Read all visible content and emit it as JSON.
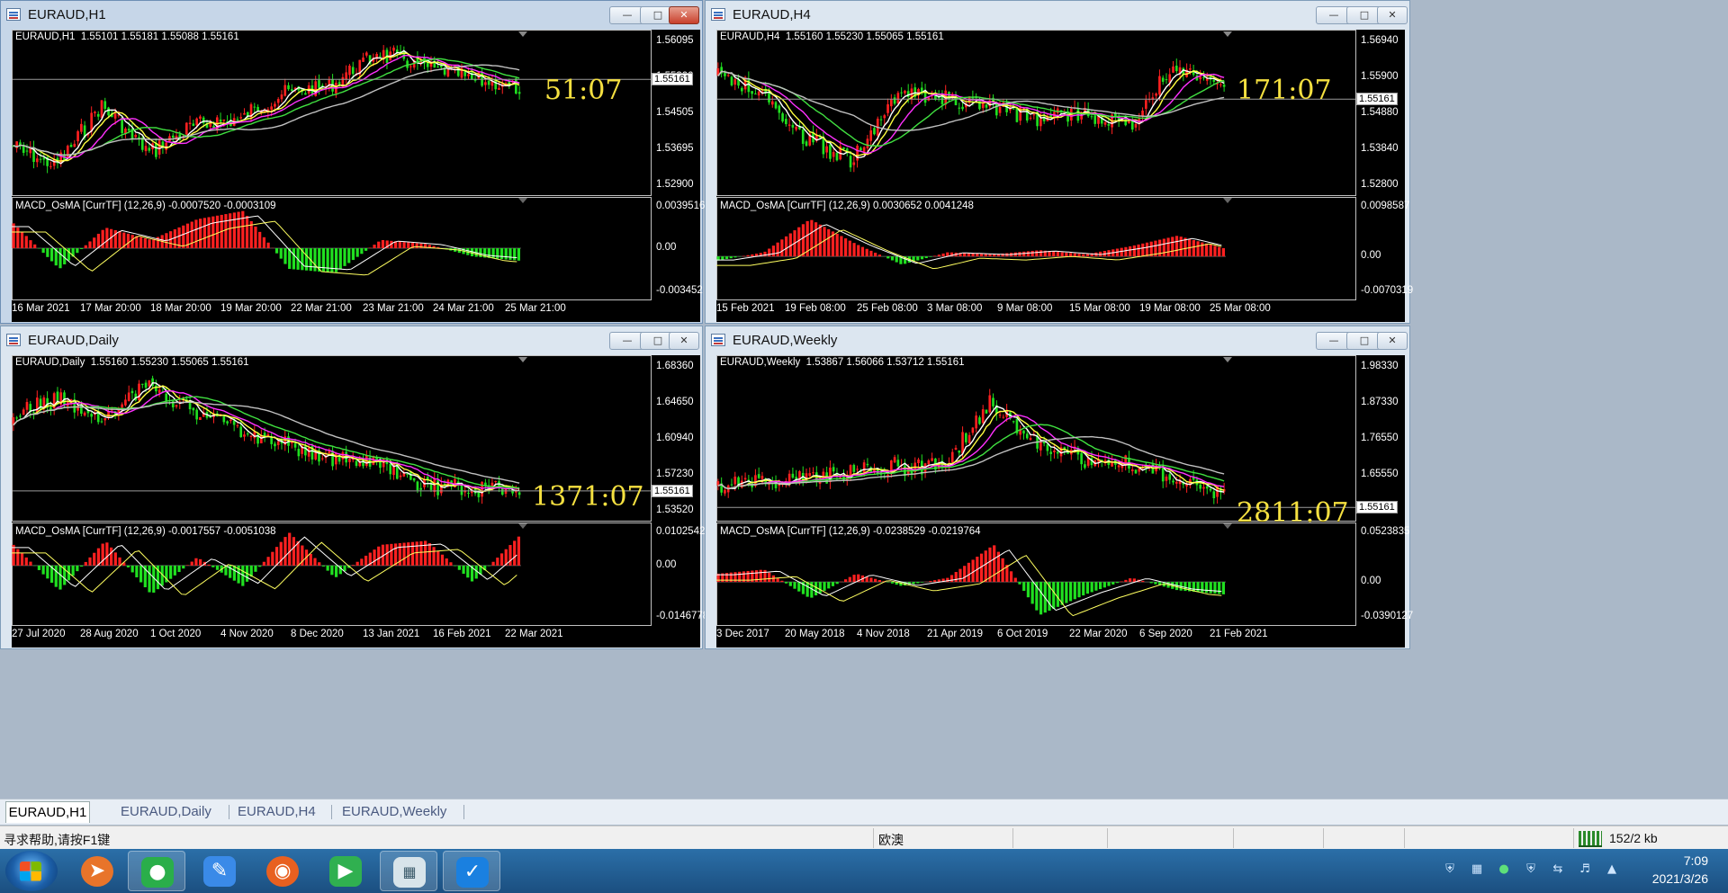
{
  "windows": [
    {
      "title": "EURAUD,H1",
      "ohlc": "EURAUD,H1  1.55101 1.55181 1.55088 1.55161",
      "osc": "MACD_OsMA [CurrTF] (12,26,9) -0.0007520 -0.0003109",
      "price_ticks": [
        "1.56095",
        "1.55300",
        "1.54505",
        "1.53695",
        "1.52900"
      ],
      "osc_ticks": [
        "0.0039516",
        "0.00",
        "-0.003452"
      ],
      "current_price": "1.55161",
      "countdown": "51:07",
      "x_ticks": [
        "16 Mar 2021",
        "17 Mar 20:00",
        "18 Mar 20:00",
        "19 Mar 20:00",
        "22 Mar 21:00",
        "23 Mar 21:00",
        "24 Mar 21:00",
        "25 Mar 21:00"
      ],
      "price_level": 0.3,
      "osc_zero_level": 0.5
    },
    {
      "title": "EURAUD,H4",
      "ohlc": "EURAUD,H4  1.55160 1.55230 1.55065 1.55161",
      "osc": "MACD_OsMA [CurrTF] (12,26,9) 0.0030652 0.0041248",
      "price_ticks": [
        "1.56940",
        "1.55900",
        "1.54880",
        "1.53840",
        "1.52800"
      ],
      "osc_ticks": [
        "0.0098587",
        "0.00",
        "-0.0070319"
      ],
      "current_price": "1.55161",
      "countdown": "171:07",
      "x_ticks": [
        "15 Feb 2021",
        "19 Feb 08:00",
        "25 Feb 08:00",
        "3 Mar 08:00",
        "9 Mar 08:00",
        "15 Mar 08:00",
        "19 Mar 08:00",
        "25 Mar 08:00"
      ],
      "price_level": 0.42,
      "osc_zero_level": 0.58
    },
    {
      "title": "EURAUD,Daily",
      "ohlc": "EURAUD,Daily  1.55160 1.55230 1.55065 1.55161",
      "osc": "MACD_OsMA [CurrTF] (12,26,9) -0.0017557 -0.0051038",
      "price_ticks": [
        "1.68360",
        "1.64650",
        "1.60940",
        "1.57230",
        "1.53520"
      ],
      "osc_ticks": [
        "0.0102542",
        "0.00",
        "-0.0146778"
      ],
      "current_price": "1.55161",
      "countdown": "1371:07",
      "x_ticks": [
        "27 Jul 2020",
        "28 Aug 2020",
        "1 Oct 2020",
        "4 Nov 2020",
        "8 Dec 2020",
        "13 Jan 2021",
        "16 Feb 2021",
        "22 Mar 2021"
      ],
      "price_level": 0.82,
      "osc_zero_level": 0.42
    },
    {
      "title": "EURAUD,Weekly",
      "ohlc": "EURAUD,Weekly  1.53867 1.56066 1.53712 1.55161",
      "osc": "MACD_OsMA [CurrTF] (12,26,9) -0.0238529 -0.0219764",
      "price_ticks": [
        "1.98330",
        "1.87330",
        "1.76550",
        "1.65550",
        "1.55161"
      ],
      "osc_ticks": [
        "0.0523835",
        "0.00",
        "-0.0390127"
      ],
      "current_price": "1.55161",
      "countdown": "2811:07",
      "x_ticks": [
        "3 Dec 2017",
        "20 May 2018",
        "4 Nov 2018",
        "21 Apr 2019",
        "6 Oct 2019",
        "22 Mar 2020",
        "6 Sep 2020",
        "21 Feb 2021"
      ],
      "price_level": 0.92,
      "osc_zero_level": 0.58
    }
  ],
  "tabs": [
    "EURAUD,H1",
    "EURAUD,Daily",
    "EURAUD,H4",
    "EURAUD,Weekly"
  ],
  "status": {
    "help": "寻求帮助,请按F1键",
    "profile": "欧澳",
    "traffic": "152/2 kb"
  },
  "clock": {
    "time": "7:09",
    "date": "2021/3/26"
  },
  "colors": {
    "bull": "#ff2020",
    "bear": "#20e020",
    "ma_fast": "#ffffff",
    "ma_yellow": "#ffff40",
    "ma_magenta": "#ff30ff",
    "ma_green": "#40e040",
    "ma_gray": "#c0c0c0",
    "countdown": "#f5e040"
  }
}
